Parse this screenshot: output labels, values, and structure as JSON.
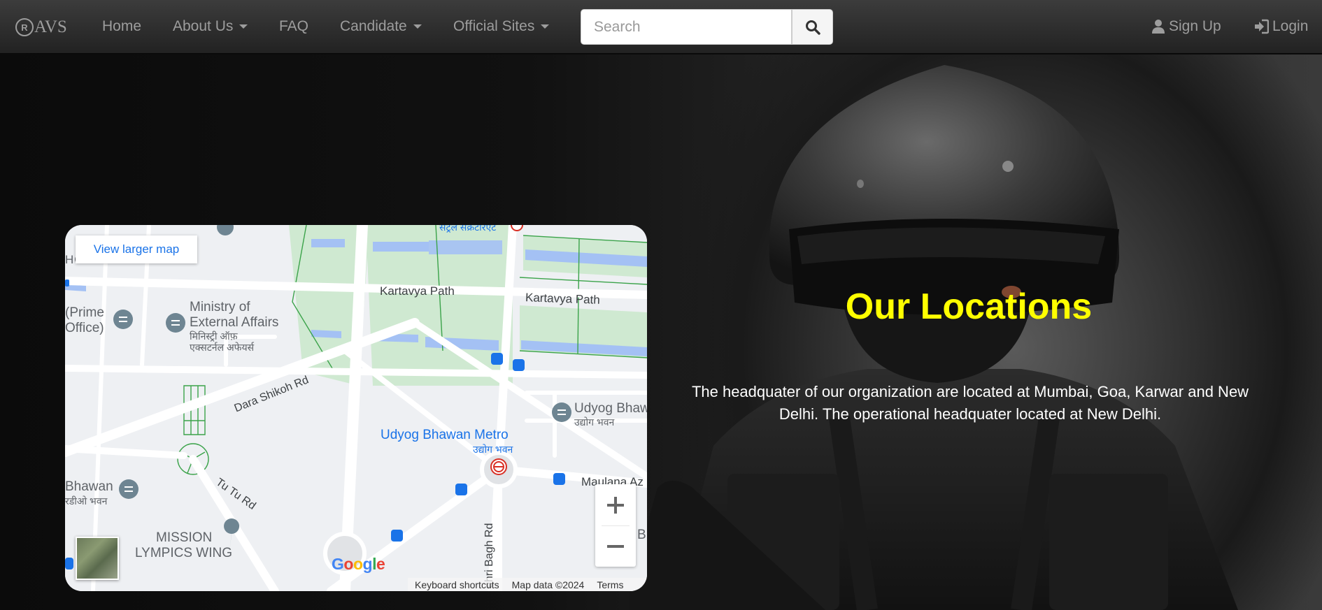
{
  "brand": {
    "reg_symbol": "R",
    "name": "AVS"
  },
  "nav": {
    "home": "Home",
    "about": "About Us",
    "faq": "FAQ",
    "candidate": "Candidate",
    "official_sites": "Official Sites",
    "search_placeholder": "Search",
    "sign_up": "Sign Up",
    "login": "Login"
  },
  "hero": {
    "headline": "Our Locations",
    "description": "The headquater of our organization are located at Mumbai, Goa, Karwar and New Delhi. The operational headquater located at New Delhi."
  },
  "map": {
    "view_larger": "View larger map",
    "labels": {
      "home_affairs": "HOME AFFAIRS",
      "hindi_secretariat": "सेंट्रल सेक्रेटेरिएट",
      "kartavya_path_1": "Kartavya Path",
      "kartavya_path_2": "Kartavya Path",
      "pm_office_1": "(Prime",
      "pm_office_2": "Office)",
      "mea_1": "Ministry of",
      "mea_2": "External Affairs",
      "mea_hi_1": "मिनिस्ट्री ऑफ़",
      "mea_hi_2": "एक्सटर्नल अफेयर्स",
      "dara_shikoh": "Dara Shikoh Rd",
      "udyog_bhawan": "Udyog Bhaw",
      "udyog_bhawan_hi": "उद्योग भवन",
      "udyog_metro": "Udyog Bhawan Metro",
      "udyog_metro_hi": "उद्योग भवन",
      "maulana": "Maulana Az",
      "bhawan": "Bhawan",
      "bhawan_hi": "रडीओ भवन",
      "tu_tu": "Tu Tu Rd",
      "mission_1": "MISSION",
      "mission_2": "LYMPICS WING",
      "motibagh": "ehri Bagh Rd",
      "b_label": "B"
    },
    "google": [
      "G",
      "o",
      "o",
      "g",
      "l",
      "e"
    ],
    "google_colors": [
      "#4285f4",
      "#ea4335",
      "#fbbc05",
      "#4285f4",
      "#34a853",
      "#ea4335"
    ],
    "attribution": {
      "shortcuts": "Keyboard shortcuts",
      "data": "Map data ©2024",
      "terms": "Terms"
    }
  },
  "colors": {
    "headline": "#ffff00",
    "nav_text": "#9d9d9d",
    "map_link": "#1a73e8"
  }
}
